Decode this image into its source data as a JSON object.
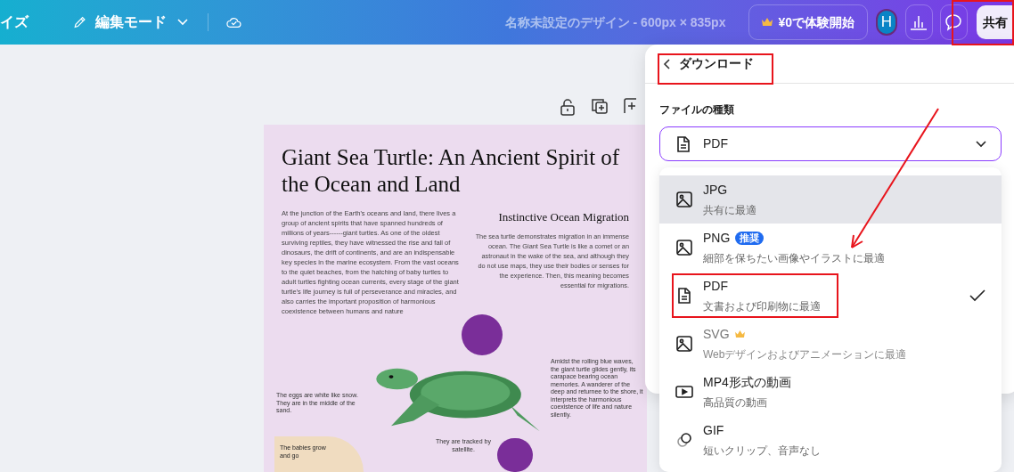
{
  "topbar": {
    "left_cut_label": "イズ",
    "mode_label": "編集モード",
    "doc_title": "名称未設定のデザイン - 600px × 835px",
    "trial_button": "¥0で体験開始",
    "avatar_initial": "H",
    "share_button": "共有"
  },
  "poster": {
    "title": "Giant Sea Turtle: An Ancient Spirit of the Ocean and Land",
    "intro": "At the junction of the Earth's oceans and land, there lives a group of ancient spirits that have spanned hundreds of millions of years------giant turtles. As one of the oldest surviving reptiles, they have witnessed the rise and fall of dinosaurs, the drift of continents, and are an indispensable key species in the marine ecosystem. From the vast oceans to the quiet beaches, from the hatching of baby turtles to adult turtles fighting ocean currents, every stage of the giant turtle's life journey is full of perseverance and miracles, and also carries the important proposition of harmonious coexistence between humans and nature",
    "migration_heading": "Instinctive Ocean Migration",
    "migration_text": "The sea turtle demonstrates migration in an immense ocean. The Giant Sea Turtle is like a comet or an astronaut in the wake of the sea, and although they do not use maps, they use their bodies or senses for the experience. Then, this meaning becomes essential for migrations.",
    "waves_note": "Amidst the rolling blue waves, the giant turtle glides gently, its carapace bearing ocean memories. A wanderer of the deep and returnee to the shore, it interprets the harmonious coexistence of life and nature silently.",
    "eggs_note": "The eggs are white like snow. They are in the middle of the sand.",
    "tracked_note": "They are tracked by satellite.",
    "babies_note": "The babies grow and go"
  },
  "download_panel": {
    "title": "ダウンロード",
    "file_type_label": "ファイルの種類",
    "file_type_value": "PDF"
  },
  "formats": [
    {
      "kind": "image",
      "name": "JPG",
      "description": "共有に最適",
      "highlighted": true,
      "selected": false,
      "premium": false
    },
    {
      "kind": "image",
      "name": "PNG",
      "badge": "推奨",
      "description": "細部を保ちたい画像やイラストに最適",
      "highlighted": false,
      "selected": false,
      "premium": false
    },
    {
      "kind": "document",
      "name": "PDF",
      "description": "文書および印刷物に最適",
      "highlighted": false,
      "selected": true,
      "premium": false
    },
    {
      "kind": "image",
      "name": "SVG",
      "description": "Webデザインおよびアニメーションに最適",
      "highlighted": false,
      "selected": false,
      "premium": true
    },
    {
      "kind": "video",
      "name": "MP4形式の動画",
      "description": "高品質の動画",
      "highlighted": false,
      "selected": false,
      "premium": false
    },
    {
      "kind": "gif",
      "name": "GIF",
      "description": "短いクリップ、音声なし",
      "highlighted": false,
      "selected": false,
      "premium": false
    }
  ]
}
